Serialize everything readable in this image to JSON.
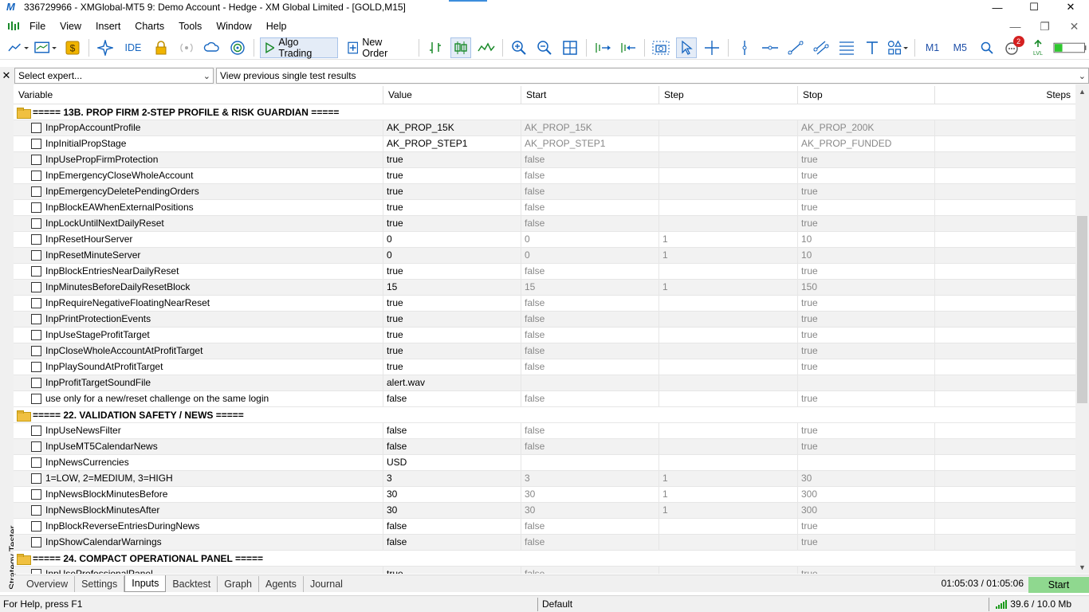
{
  "window": {
    "title": "336729966 - XMGlobal-MT5 9: Demo Account - Hedge - XM Global Limited - [GOLD,M15]",
    "controls": [
      "minimize-icon",
      "maximize-icon",
      "close-icon"
    ]
  },
  "menu": {
    "items": [
      "File",
      "View",
      "Insert",
      "Charts",
      "Tools",
      "Window",
      "Help"
    ]
  },
  "toolbar": {
    "ide_label": "IDE",
    "algo_trading_label": "Algo Trading",
    "new_order_label": "New Order",
    "timeframes": [
      "M1",
      "M5"
    ],
    "notification_count": "2",
    "accent_green": "#1a8a2a",
    "accent_blue": "#1565c0"
  },
  "expert_bar": {
    "expert_select": "Select expert...",
    "mode_select": "View previous single test results"
  },
  "side_label": "Strategy Tester",
  "grid": {
    "headers": [
      "Variable",
      "Value",
      "Start",
      "Step",
      "Stop",
      "Steps"
    ],
    "groups": [
      {
        "title": "===== 13B. PROP FIRM 2-STEP PROFILE & RISK GUARDIAN =====",
        "rows": [
          {
            "var": "InpPropAccountProfile",
            "value": "AK_PROP_15K",
            "start": "AK_PROP_15K",
            "step": "",
            "stop": "AK_PROP_200K",
            "steps": ""
          },
          {
            "var": "InpInitialPropStage",
            "value": "AK_PROP_STEP1",
            "start": "AK_PROP_STEP1",
            "step": "",
            "stop": "AK_PROP_FUNDED",
            "steps": ""
          },
          {
            "var": "InpUsePropFirmProtection",
            "value": "true",
            "start": "false",
            "step": "",
            "stop": "true",
            "steps": ""
          },
          {
            "var": "InpEmergencyCloseWholeAccount",
            "value": "true",
            "start": "false",
            "step": "",
            "stop": "true",
            "steps": ""
          },
          {
            "var": "InpEmergencyDeletePendingOrders",
            "value": "true",
            "start": "false",
            "step": "",
            "stop": "true",
            "steps": ""
          },
          {
            "var": "InpBlockEAWhenExternalPositions",
            "value": "true",
            "start": "false",
            "step": "",
            "stop": "true",
            "steps": ""
          },
          {
            "var": "InpLockUntilNextDailyReset",
            "value": "true",
            "start": "false",
            "step": "",
            "stop": "true",
            "steps": ""
          },
          {
            "var": "InpResetHourServer",
            "value": "0",
            "start": "0",
            "step": "1",
            "stop": "10",
            "steps": ""
          },
          {
            "var": "InpResetMinuteServer",
            "value": "0",
            "start": "0",
            "step": "1",
            "stop": "10",
            "steps": ""
          },
          {
            "var": "InpBlockEntriesNearDailyReset",
            "value": "true",
            "start": "false",
            "step": "",
            "stop": "true",
            "steps": ""
          },
          {
            "var": "InpMinutesBeforeDailyResetBlock",
            "value": "15",
            "start": "15",
            "step": "1",
            "stop": "150",
            "steps": ""
          },
          {
            "var": "InpRequireNegativeFloatingNearReset",
            "value": "true",
            "start": "false",
            "step": "",
            "stop": "true",
            "steps": ""
          },
          {
            "var": "InpPrintProtectionEvents",
            "value": "true",
            "start": "false",
            "step": "",
            "stop": "true",
            "steps": ""
          },
          {
            "var": "InpUseStageProfitTarget",
            "value": "true",
            "start": "false",
            "step": "",
            "stop": "true",
            "steps": ""
          },
          {
            "var": "InpCloseWholeAccountAtProfitTarget",
            "value": "true",
            "start": "false",
            "step": "",
            "stop": "true",
            "steps": ""
          },
          {
            "var": "InpPlaySoundAtProfitTarget",
            "value": "true",
            "start": "false",
            "step": "",
            "stop": "true",
            "steps": ""
          },
          {
            "var": "InpProfitTargetSoundFile",
            "value": "alert.wav",
            "start": "",
            "step": "",
            "stop": "",
            "steps": ""
          },
          {
            "var": "use only for a new/reset challenge on the same login",
            "value": "false",
            "start": "false",
            "step": "",
            "stop": "true",
            "steps": ""
          }
        ]
      },
      {
        "title": "===== 22. VALIDATION SAFETY / NEWS =====",
        "rows": [
          {
            "var": "InpUseNewsFilter",
            "value": "false",
            "start": "false",
            "step": "",
            "stop": "true",
            "steps": ""
          },
          {
            "var": "InpUseMT5CalendarNews",
            "value": "false",
            "start": "false",
            "step": "",
            "stop": "true",
            "steps": ""
          },
          {
            "var": "InpNewsCurrencies",
            "value": "USD",
            "start": "",
            "step": "",
            "stop": "",
            "steps": ""
          },
          {
            "var": "1=LOW, 2=MEDIUM, 3=HIGH",
            "value": "3",
            "start": "3",
            "step": "1",
            "stop": "30",
            "steps": ""
          },
          {
            "var": "InpNewsBlockMinutesBefore",
            "value": "30",
            "start": "30",
            "step": "1",
            "stop": "300",
            "steps": ""
          },
          {
            "var": "InpNewsBlockMinutesAfter",
            "value": "30",
            "start": "30",
            "step": "1",
            "stop": "300",
            "steps": ""
          },
          {
            "var": "InpBlockReverseEntriesDuringNews",
            "value": "false",
            "start": "false",
            "step": "",
            "stop": "true",
            "steps": ""
          },
          {
            "var": "InpShowCalendarWarnings",
            "value": "false",
            "start": "false",
            "step": "",
            "stop": "true",
            "steps": ""
          }
        ]
      },
      {
        "title": "===== 24. COMPACT OPERATIONAL PANEL =====",
        "rows": [
          {
            "var": "InpUseProfessionalPanel",
            "value": "true",
            "start": "false",
            "step": "",
            "stop": "true",
            "steps": ""
          }
        ]
      }
    ]
  },
  "tabs": {
    "items": [
      "Overview",
      "Settings",
      "Inputs",
      "Backtest",
      "Graph",
      "Agents",
      "Journal"
    ],
    "active": "Inputs",
    "timer": "01:05:03 / 01:05:06",
    "start_label": "Start",
    "start_color": "#8fd88f"
  },
  "status": {
    "help": "For Help, press F1",
    "profile": "Default",
    "connection": "39.6 / 10.0 Mb"
  }
}
